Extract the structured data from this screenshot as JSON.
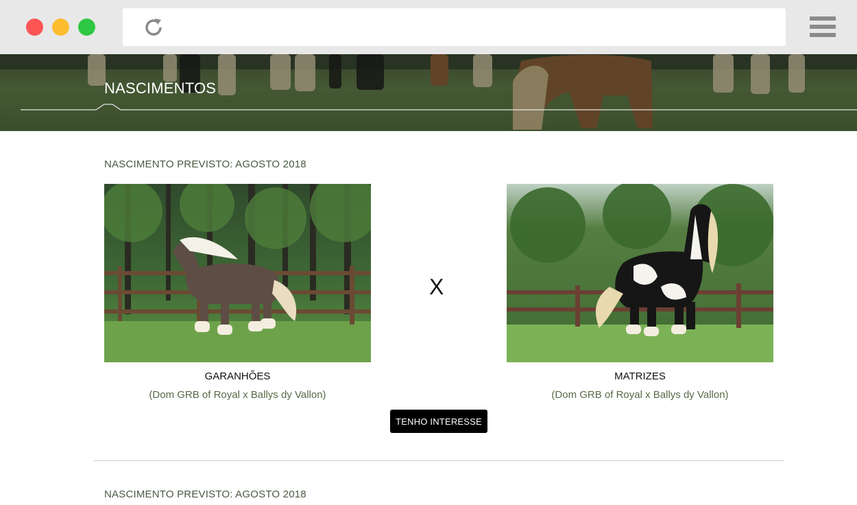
{
  "browser": {
    "window_controls": [
      "close",
      "minimize",
      "maximize"
    ],
    "reload_icon": "reload-icon",
    "menu_icon": "hamburger-menu-icon"
  },
  "hero": {
    "title": "NASCIMENTOS"
  },
  "births": [
    {
      "label": "NASCIMENTO PREVISTO: AGOSTO 2018",
      "separator": "X",
      "stallion": {
        "title": "GARANHÕES",
        "subtitle": "(Dom GRB of Royal x Ballys dy Vallon)"
      },
      "mare": {
        "title": "MATRIZES",
        "subtitle": "(Dom GRB of Royal x Ballys dy Vallon)"
      },
      "cta": "TENHO INTERESSE"
    },
    {
      "label": "NASCIMENTO PREVISTO: AGOSTO 2018"
    }
  ],
  "colors": {
    "chrome_bg": "#e8e8e8",
    "close": "#fd5454",
    "minimize": "#fcbd2f",
    "maximize": "#2ec843",
    "label_text": "#4b5a44",
    "cta_bg": "#000000"
  }
}
